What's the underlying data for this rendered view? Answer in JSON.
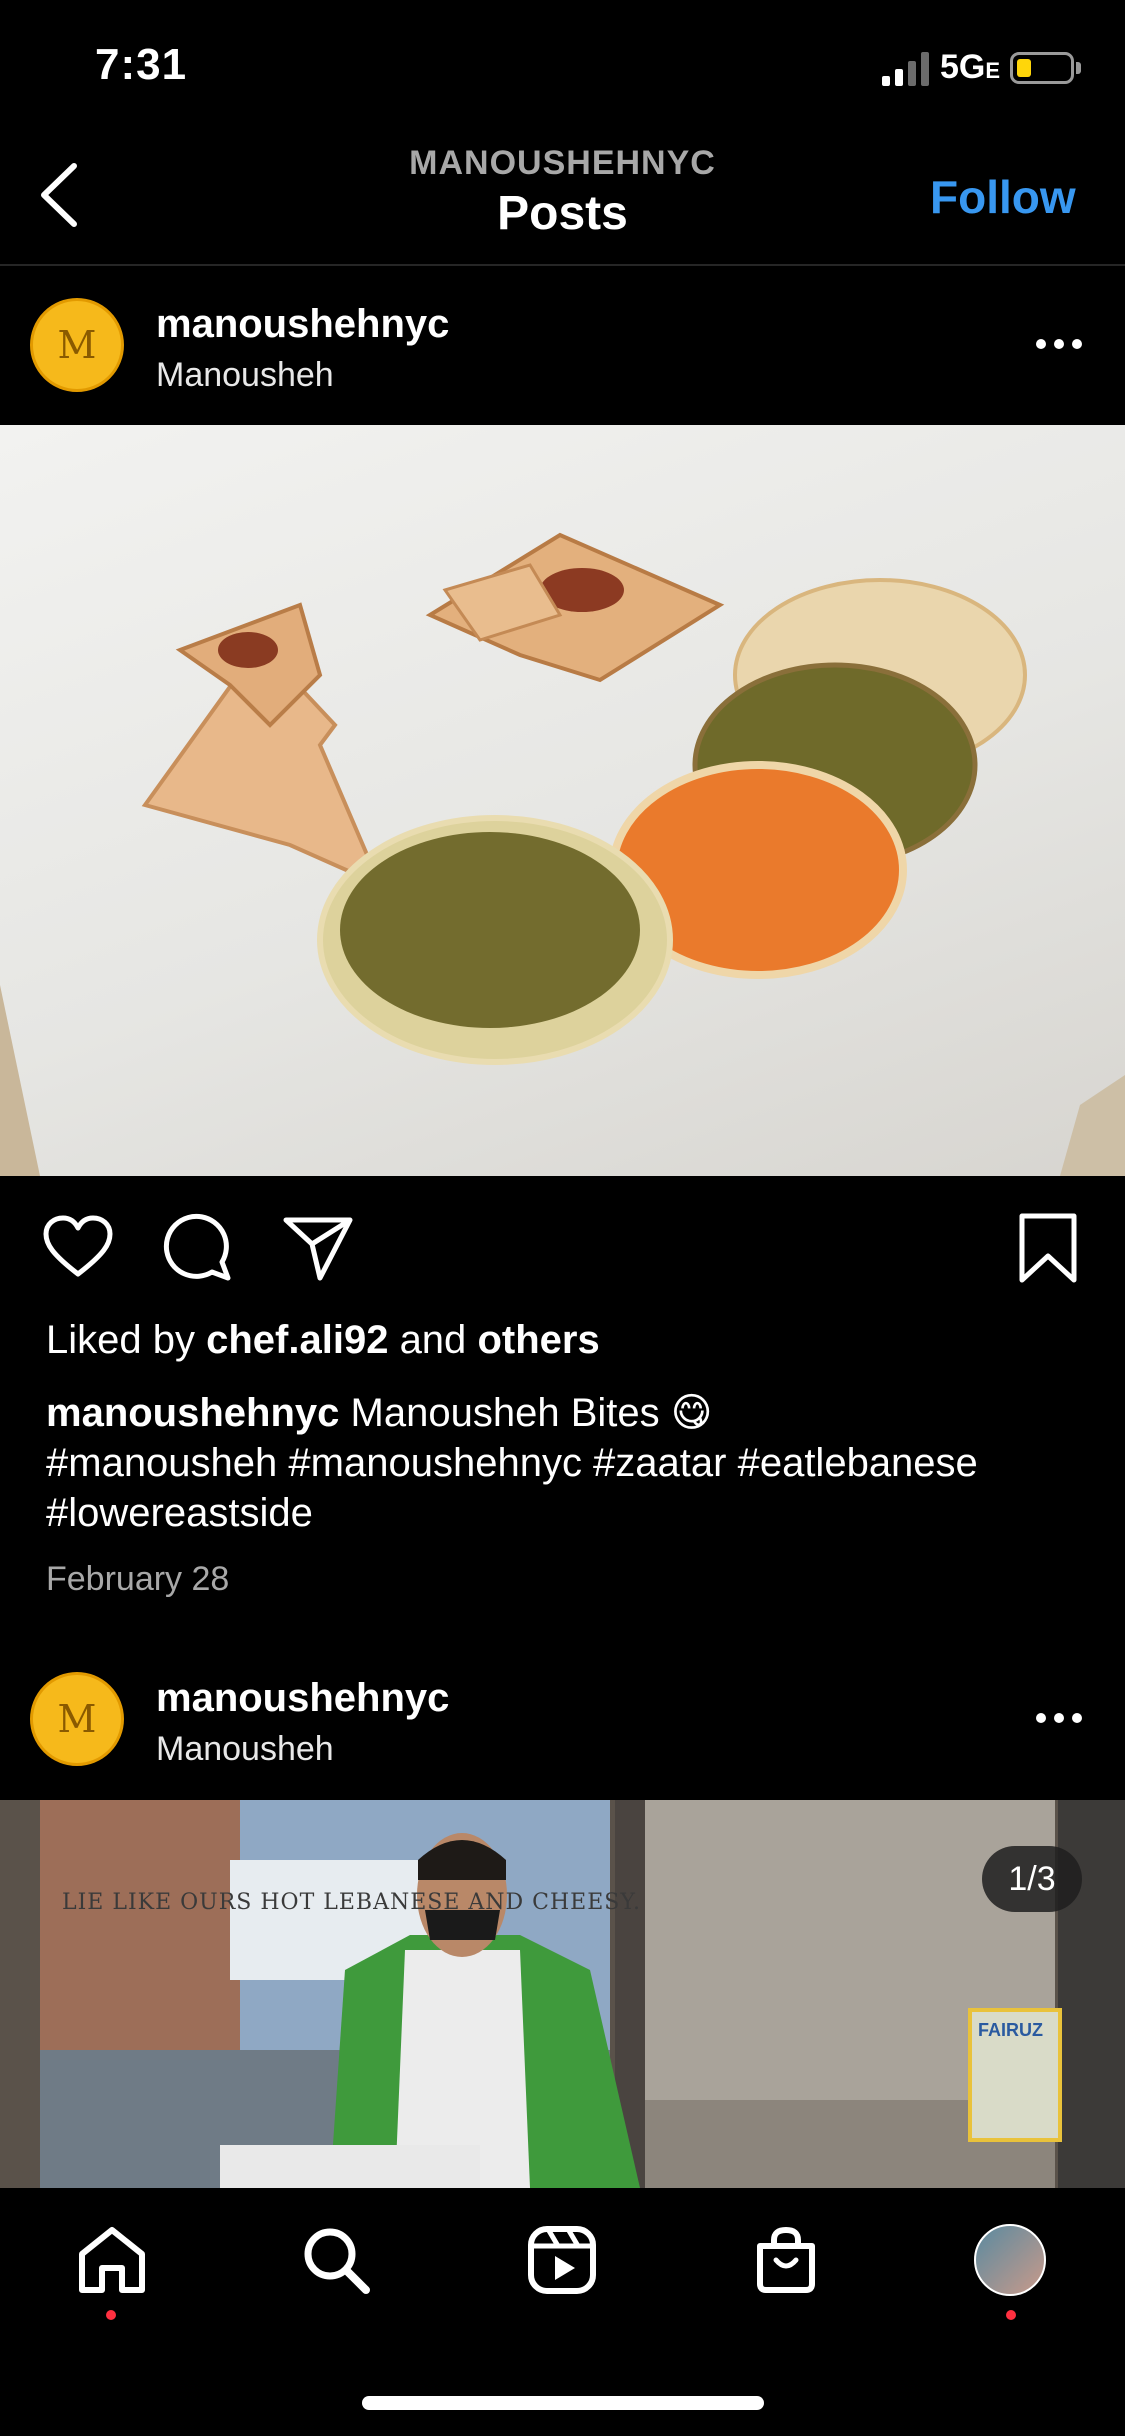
{
  "status_bar": {
    "time": "7:31",
    "network": "5G",
    "network_suffix": "E",
    "battery_level": 0.15
  },
  "header": {
    "account": "MANOUSHEHNYC",
    "title": "Posts",
    "follow_label": "Follow"
  },
  "posts": [
    {
      "username": "manoushehnyc",
      "location": "Manousheh",
      "avatar_letter": "M",
      "liked_prefix": "Liked by",
      "liked_user": "chef.ali92",
      "liked_and": "and",
      "liked_others": "others",
      "caption_user": "manoushehnyc",
      "caption_text": "Manousheh Bites 😋",
      "caption_tags": "#manousheh #manoushehnyc #zaatar #eatlebanese #lowereastside",
      "date": "February 28"
    },
    {
      "username": "manoushehnyc",
      "location": "Manousheh",
      "avatar_letter": "M",
      "image_counter": "1/3",
      "window_sign": "LIE LIKE OURS HOT LEBANESE AND CHEESY.",
      "poster_text": "FAIRUZ"
    }
  ],
  "nav": {
    "items": [
      "home",
      "search",
      "reels",
      "shop",
      "profile"
    ]
  },
  "colors": {
    "accent": "#3897f0",
    "badge": "#ff3040",
    "avatar": "#f6b91b"
  }
}
